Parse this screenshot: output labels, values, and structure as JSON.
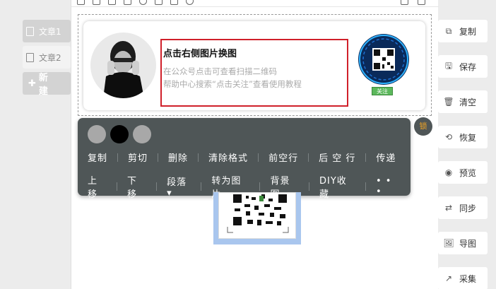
{
  "articles": [
    {
      "label": "文章1",
      "active": true
    },
    {
      "label": "文章2",
      "active": false
    }
  ],
  "new_label": "新 建",
  "card": {
    "title": "点击右侧图片换图",
    "desc_line1": "在公众号点击可查看扫描二维码",
    "desc_line2": "帮助中心搜索“点击关注”查看使用教程",
    "follow_tag": "关注"
  },
  "lock_label": "锁",
  "popup": {
    "colors": [
      "#a8a8a8",
      "#000000",
      "#a8a8a8"
    ],
    "row1": [
      "复制",
      "剪切",
      "删除",
      "清除格式",
      "前空行",
      "后 空 行",
      "传递"
    ],
    "row2": [
      "上移",
      "下移",
      "段落▾",
      "转为图片",
      "背景图",
      "DIY收藏",
      "• • •"
    ]
  },
  "actions": [
    {
      "label": "复制",
      "icon": "copy-icon"
    },
    {
      "label": "保存",
      "icon": "save-icon"
    },
    {
      "label": "清空",
      "icon": "trash-icon"
    },
    {
      "label": "恢复",
      "icon": "restore-icon"
    },
    {
      "label": "预览",
      "icon": "eye-icon"
    },
    {
      "label": "同步",
      "icon": "sync-icon"
    },
    {
      "label": "导图",
      "icon": "image-icon"
    },
    {
      "label": "采集",
      "icon": "collect-icon"
    }
  ]
}
